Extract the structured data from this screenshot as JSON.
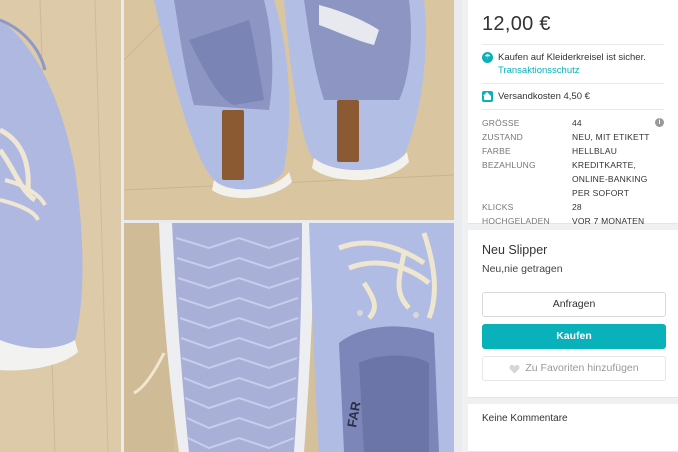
{
  "listing": {
    "price": "12,00 €",
    "protection_text": "Kaufen auf Kleiderkreisel ist sicher.",
    "protection_link": "Transaktionsschutz",
    "shipping_text": "Versandkosten 4,50 €",
    "details": [
      {
        "key": "GRÖSSE",
        "value": "44"
      },
      {
        "key": "ZUSTAND",
        "value": "NEU, MIT ETIKETT"
      },
      {
        "key": "FARBE",
        "value": "HELLBLAU"
      },
      {
        "key": "BEZAHLUNG",
        "value": "KREDITKARTE, ONLINE-BANKING PER SOFORT"
      },
      {
        "key": "KLICKS",
        "value": "28"
      },
      {
        "key": "HOCHGELADEN",
        "value": "VOR 7 MONATEN"
      }
    ],
    "title": "Neu Slipper",
    "description": "Neu,nie getragen",
    "ask_button": "Anfragen",
    "buy_button": "Kaufen",
    "favorite_button": "Zu Favoriten hinzufügen",
    "comments_label": "Keine Kommentare"
  },
  "photos": {
    "insole_text": "FAR"
  },
  "colors": {
    "accent": "#09b1ba",
    "shoe_blue": "#a9b4de",
    "floor": "#d9c6a3"
  },
  "icons": [
    "umbrella-icon",
    "house-icon",
    "info-icon",
    "heart-icon"
  ]
}
